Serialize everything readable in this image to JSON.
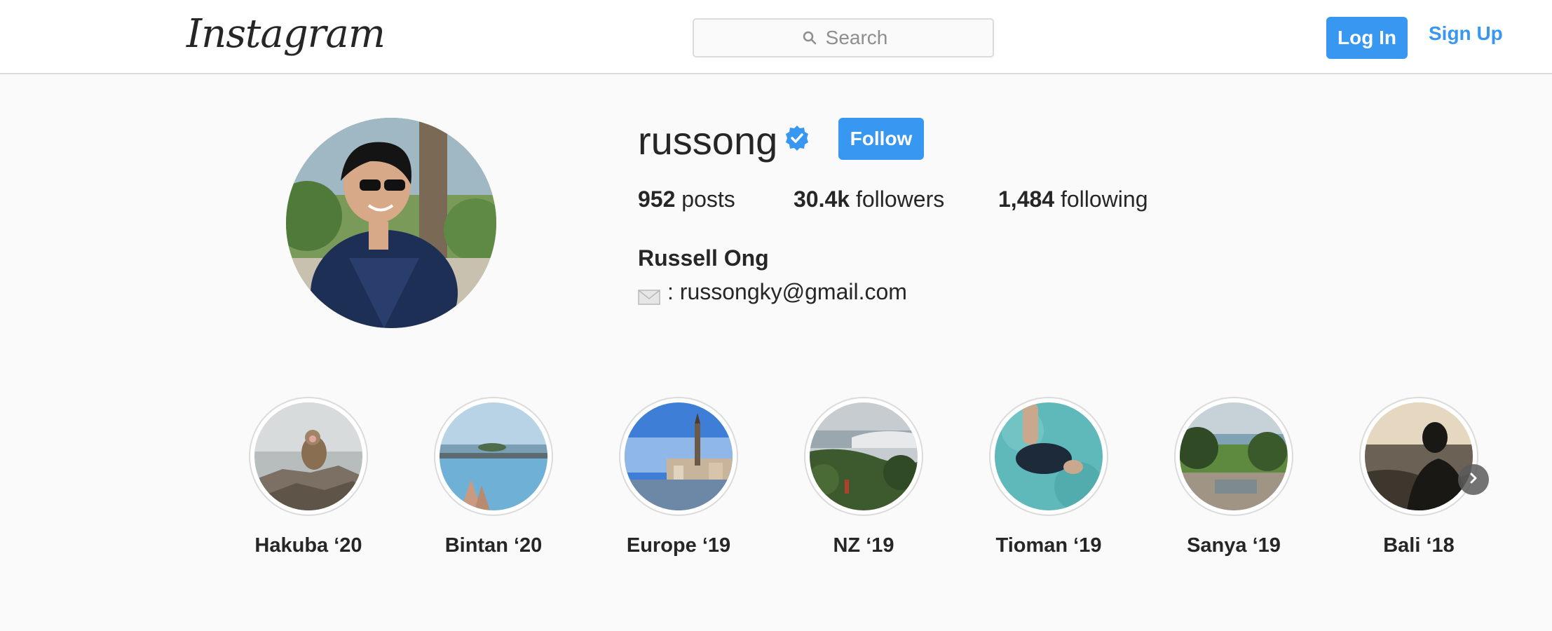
{
  "header": {
    "logo": "Instagram",
    "search_placeholder": "Search",
    "login_label": "Log In",
    "signup_label": "Sign Up"
  },
  "profile": {
    "username": "russong",
    "verified": true,
    "follow_label": "Follow",
    "stats": {
      "posts_value": "952",
      "posts_label": "posts",
      "followers_value": "30.4k",
      "followers_label": "followers",
      "following_value": "1,484",
      "following_label": "following"
    },
    "full_name": "Russell Ong",
    "bio_email": ": russongky@gmail.com"
  },
  "highlights": [
    {
      "label": "Hakuba ‘20"
    },
    {
      "label": "Bintan ‘20"
    },
    {
      "label": "Europe ‘19"
    },
    {
      "label": "NZ ‘19"
    },
    {
      "label": "Tioman ‘19"
    },
    {
      "label": "Sanya ‘19"
    },
    {
      "label": "Bali ‘18"
    }
  ],
  "colors": {
    "accent": "#3897f0",
    "text": "#262626",
    "muted": "#8e8e8e",
    "border": "#dbdbdb",
    "background": "#fafafa"
  },
  "icons": [
    "search-icon",
    "verified-badge-icon",
    "envelope-icon",
    "chevron-right-icon"
  ]
}
